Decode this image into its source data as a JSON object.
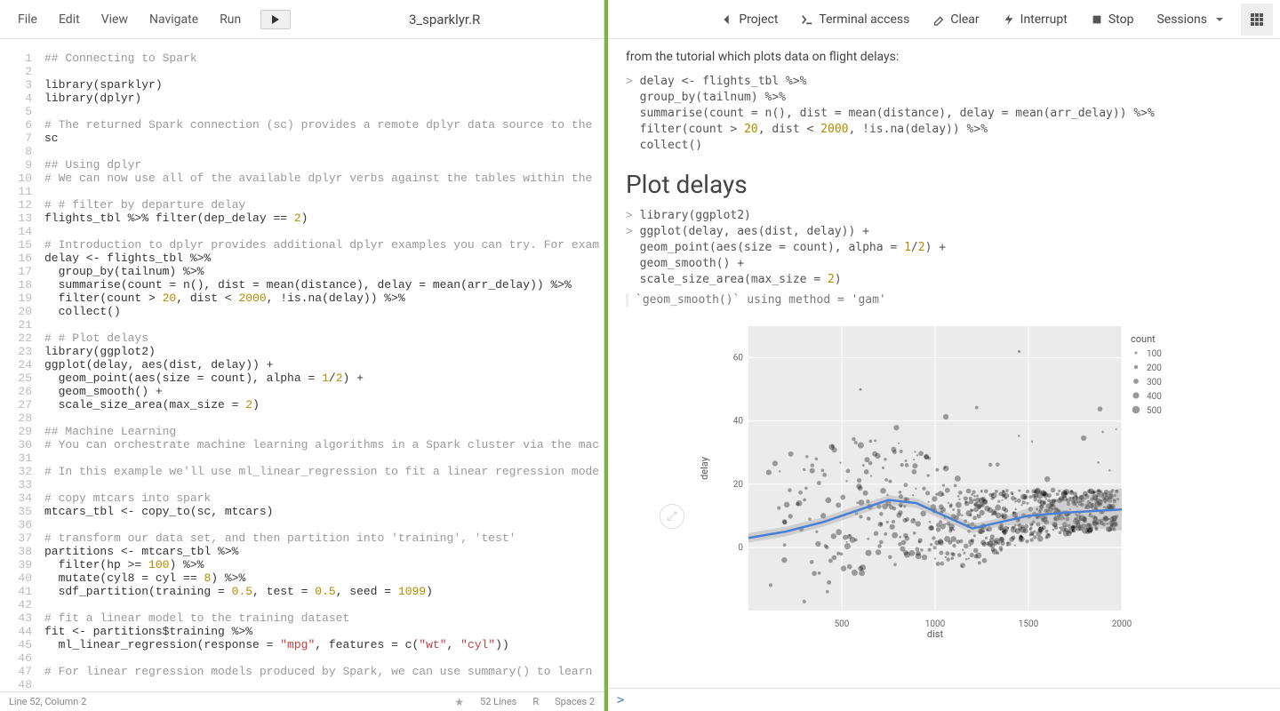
{
  "menubar": {
    "items": [
      "File",
      "Edit",
      "View",
      "Navigate",
      "Run"
    ],
    "filename": "3_sparklyr.R"
  },
  "code": {
    "lines": [
      {
        "n": 1,
        "t": "## Connecting to Spark",
        "cls": "c-comment"
      },
      {
        "n": 2,
        "t": ""
      },
      {
        "n": 3,
        "t": "library(sparklyr)"
      },
      {
        "n": 4,
        "t": "library(dplyr)"
      },
      {
        "n": 5,
        "t": ""
      },
      {
        "n": 6,
        "t": "# The returned Spark connection (sc) provides a remote dplyr data source to the",
        "cls": "c-comment"
      },
      {
        "n": 7,
        "t": "sc"
      },
      {
        "n": 8,
        "t": ""
      },
      {
        "n": 9,
        "t": "## Using dplyr",
        "cls": "c-comment"
      },
      {
        "n": 10,
        "t": "# We can now use all of the available dplyr verbs against the tables within the",
        "cls": "c-comment"
      },
      {
        "n": 11,
        "t": ""
      },
      {
        "n": 12,
        "t": "# # filter by departure delay",
        "cls": "c-comment"
      },
      {
        "n": 13,
        "h": "flights_tbl %>% filter(dep_delay == <span class='c-num'>2</span>)"
      },
      {
        "n": 14,
        "t": ""
      },
      {
        "n": 15,
        "t": "# Introduction to dplyr provides additional dplyr examples you can try. For exam",
        "cls": "c-comment"
      },
      {
        "n": 16,
        "t": "delay <- flights_tbl %>%"
      },
      {
        "n": 17,
        "t": "  group_by(tailnum) %>%"
      },
      {
        "n": 18,
        "t": "  summarise(count = n(), dist = mean(distance), delay = mean(arr_delay)) %>%"
      },
      {
        "n": 19,
        "h": "  filter(count > <span class='c-num'>20</span>, dist < <span class='c-num'>2000</span>, !is.na(delay)) %>%"
      },
      {
        "n": 20,
        "t": "  collect()"
      },
      {
        "n": 21,
        "t": ""
      },
      {
        "n": 22,
        "t": "# # Plot delays",
        "cls": "c-comment"
      },
      {
        "n": 23,
        "t": "library(ggplot2)"
      },
      {
        "n": 24,
        "t": "ggplot(delay, aes(dist, delay)) +"
      },
      {
        "n": 25,
        "h": "  geom_point(aes(size = count), alpha = <span class='c-num'>1</span>/<span class='c-num'>2</span>) +"
      },
      {
        "n": 26,
        "t": "  geom_smooth() +"
      },
      {
        "n": 27,
        "h": "  scale_size_area(max_size = <span class='c-num'>2</span>)"
      },
      {
        "n": 28,
        "t": ""
      },
      {
        "n": 29,
        "t": "## Machine Learning",
        "cls": "c-comment"
      },
      {
        "n": 30,
        "t": "# You can orchestrate machine learning algorithms in a Spark cluster via the mac",
        "cls": "c-comment"
      },
      {
        "n": 31,
        "t": ""
      },
      {
        "n": 32,
        "t": "# In this example we'll use ml_linear_regression to fit a linear regression mode",
        "cls": "c-comment"
      },
      {
        "n": 33,
        "t": ""
      },
      {
        "n": 34,
        "t": "# copy mtcars into spark",
        "cls": "c-comment"
      },
      {
        "n": 35,
        "t": "mtcars_tbl <- copy_to(sc, mtcars)"
      },
      {
        "n": 36,
        "t": ""
      },
      {
        "n": 37,
        "t": "# transform our data set, and then partition into 'training', 'test'",
        "cls": "c-comment"
      },
      {
        "n": 38,
        "t": "partitions <- mtcars_tbl %>%"
      },
      {
        "n": 39,
        "h": "  filter(hp >= <span class='c-num'>100</span>) %>%"
      },
      {
        "n": 40,
        "h": "  mutate(cyl8 = cyl == <span class='c-num'>8</span>) %>%"
      },
      {
        "n": 41,
        "h": "  sdf_partition(training = <span class='c-num'>0.5</span>, test = <span class='c-num'>0.5</span>, seed = <span class='c-num'>1099</span>)"
      },
      {
        "n": 42,
        "t": ""
      },
      {
        "n": 43,
        "t": "# fit a linear model to the training dataset",
        "cls": "c-comment"
      },
      {
        "n": 44,
        "t": "fit <- partitions$training %>%"
      },
      {
        "n": 45,
        "h": "  ml_linear_regression(response = <span class='c-str'>\"mpg\"</span>, features = c(<span class='c-str'>\"wt\"</span>, <span class='c-str'>\"cyl\"</span>))"
      },
      {
        "n": 46,
        "t": ""
      },
      {
        "n": 47,
        "t": "# For linear regression models produced by Spark, we can use summary() to learn ",
        "cls": "c-comment"
      },
      {
        "n": 48,
        "t": ""
      }
    ]
  },
  "statusbar": {
    "position": "Line 52, Column 2",
    "lines": "52 Lines",
    "lang": "R",
    "spaces": "Spaces  2"
  },
  "toolbar": {
    "buttons": [
      {
        "id": "project",
        "label": "Project",
        "icon": "arrow-left"
      },
      {
        "id": "terminal",
        "label": "Terminal access",
        "icon": "terminal"
      },
      {
        "id": "clear",
        "label": "Clear",
        "icon": "eraser"
      },
      {
        "id": "interrupt",
        "label": "Interrupt",
        "icon": "bolt"
      },
      {
        "id": "stop",
        "label": "Stop",
        "icon": "stop"
      },
      {
        "id": "sessions",
        "label": "Sessions",
        "icon": "",
        "dropdown": true
      }
    ]
  },
  "output": {
    "intro": "from the tutorial which plots data on flight delays:",
    "block1": {
      "l1": "delay <- flights_tbl %>%",
      "l2": "  group_by(tailnum) %>%",
      "l3": "  summarise(count = n(), dist = mean(distance), delay = mean(arr_delay)) %>%",
      "l4p": "  filter(count > ",
      "n1": "20",
      "l4m": ", dist < ",
      "n2": "2000",
      "l4s": ", !is.na(delay)) %>%",
      "l5": "  collect()"
    },
    "heading": "Plot delays",
    "block2": {
      "l1": "library(ggplot2)",
      "l2": "ggplot(delay, aes(dist, delay)) +",
      "l3p": "  geom_point(aes(size = count), alpha = ",
      "n1": "1",
      "slash": "/",
      "n2": "2",
      "l3s": ") +",
      "l4": "  geom_smooth() +",
      "l5p": "  scale_size_area(max_size = ",
      "n3": "2",
      "l5s": ")"
    },
    "message": "`geom_smooth()` using method = 'gam'"
  },
  "prompt": ">",
  "chart_data": {
    "type": "scatter",
    "title": "",
    "xlabel": "dist",
    "ylabel": "delay",
    "xlim": [
      0,
      2000
    ],
    "ylim": [
      -20,
      70
    ],
    "xticks": [
      500,
      1000,
      1500,
      2000
    ],
    "yticks": [
      0,
      20,
      40,
      60
    ],
    "legend": {
      "title": "count",
      "values": [
        100,
        200,
        300,
        400,
        500
      ]
    },
    "smooth_line": [
      {
        "x": 0,
        "y": 3
      },
      {
        "x": 200,
        "y": 5
      },
      {
        "x": 400,
        "y": 8
      },
      {
        "x": 600,
        "y": 12
      },
      {
        "x": 750,
        "y": 15
      },
      {
        "x": 900,
        "y": 14
      },
      {
        "x": 1050,
        "y": 10
      },
      {
        "x": 1200,
        "y": 6
      },
      {
        "x": 1350,
        "y": 8
      },
      {
        "x": 1500,
        "y": 10
      },
      {
        "x": 1700,
        "y": 11
      },
      {
        "x": 2000,
        "y": 12
      }
    ],
    "n_points": 700
  }
}
